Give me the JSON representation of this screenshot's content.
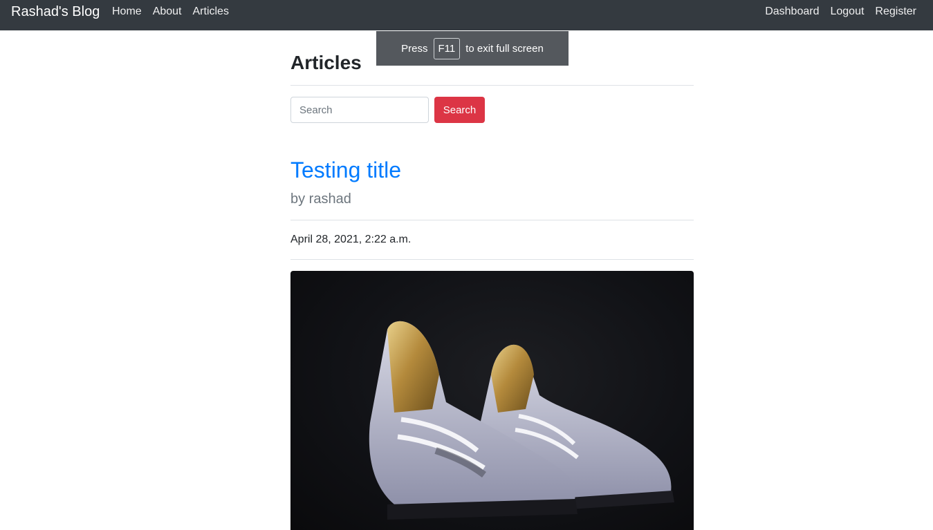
{
  "navbar": {
    "brand": "Rashad's Blog",
    "left_links": [
      "Home",
      "About",
      "Articles"
    ],
    "right_links": [
      "Dashboard",
      "Logout",
      "Register"
    ]
  },
  "fullscreen_notice": {
    "prefix": "Press",
    "key": "F11",
    "suffix": "to exit full screen"
  },
  "page": {
    "title": "Articles"
  },
  "search": {
    "placeholder": "Search",
    "value": "",
    "button_label": "Search"
  },
  "article": {
    "title": "Testing title",
    "byline": "by rashad",
    "date": "April 28, 2021, 2:22 a.m.",
    "image_alt": "white and gold sneakers on dark background"
  },
  "colors": {
    "navbar_bg": "#343a40",
    "accent_link": "#007bff",
    "search_button": "#dc3545"
  }
}
